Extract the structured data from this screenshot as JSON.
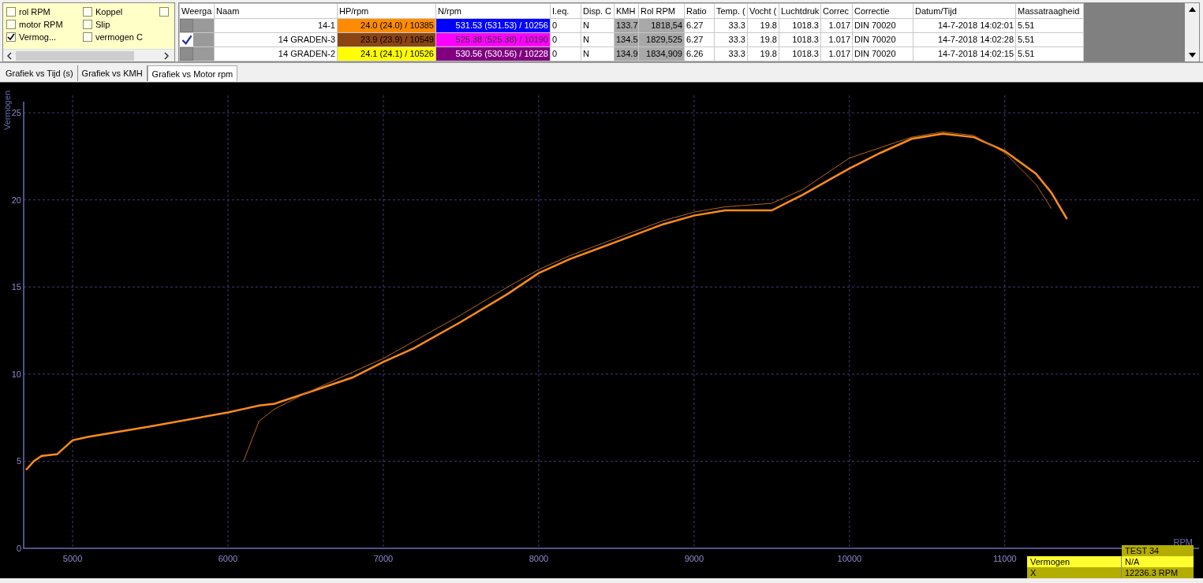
{
  "option_rows": [
    [
      {
        "label": "rol RPM",
        "checked": false
      },
      {
        "label": "Koppel",
        "checked": false
      },
      {
        "checked": false
      }
    ],
    [
      {
        "label": "motor RPM",
        "checked": false
      },
      {
        "label": "Slip",
        "checked": false
      }
    ],
    [
      {
        "label": "Vermog...",
        "checked": true
      },
      {
        "label": "vermogen C",
        "checked": false
      }
    ]
  ],
  "table": {
    "columns": [
      "Weerga",
      "Naam",
      "HP/rpm",
      "N/rpm",
      "I.eq.",
      "Disp. C",
      "KMH",
      "Rol RPM",
      "Ratio",
      "Temp. (",
      "Vocht (",
      "Luchtdruk",
      "Correc",
      "Correctie",
      "Datum/Tijd",
      "Massatraagheid"
    ],
    "rows": [
      {
        "shown": false,
        "naam": "14-1",
        "hp": {
          "text": "24.0 (24.0) / 10385",
          "color": "#ff8c00"
        },
        "n": {
          "text": "531.53 (531.53) / 10256",
          "color": "#0000ff"
        },
        "ieq": "0",
        "disp": "N",
        "kmh": "133.7",
        "rol_rpm": "1818,54",
        "ratio": "6.27",
        "temp": "33.3",
        "vocht": "19.8",
        "luchtdruk": "1018.3",
        "correc": "1.017",
        "correctie": "DIN 70020",
        "datum": "14-7-2018 14:02:01",
        "massa": "5.51"
      },
      {
        "shown": true,
        "naam": "14 GRADEN-3",
        "hp": {
          "text": "23.9 (23.9) / 10549",
          "color": "#8b4513"
        },
        "n": {
          "text": "525.38 (525.38) / 10190",
          "color": "#ff00ff"
        },
        "ieq": "0",
        "disp": "N",
        "kmh": "134.5",
        "rol_rpm": "1829,525",
        "ratio": "6.27",
        "temp": "33.3",
        "vocht": "19.8",
        "luchtdruk": "1018.3",
        "correc": "1.017",
        "correctie": "DIN 70020",
        "datum": "14-7-2018 14:02:28",
        "massa": "5.51"
      },
      {
        "shown": false,
        "naam": "14 GRADEN-2",
        "hp": {
          "text": "24.1 (24.1) / 10526",
          "color": "#ffff00"
        },
        "n": {
          "text": "530.56 (530.56) / 10228",
          "color": "#800080"
        },
        "ieq": "0",
        "disp": "N",
        "kmh": "134.9",
        "rol_rpm": "1834,909",
        "ratio": "6.26",
        "temp": "33.3",
        "vocht": "19.8",
        "luchtdruk": "1018.3",
        "correc": "1.017",
        "correctie": "DIN 70020",
        "datum": "14-7-2018 14:02:15",
        "massa": "5.51"
      }
    ]
  },
  "tabs": [
    {
      "label": "Grafiek vs Tijd (s)",
      "selected": false
    },
    {
      "label": "Grafiek vs KMH",
      "selected": false
    },
    {
      "label": "Grafiek vs Motor rpm",
      "selected": true
    }
  ],
  "chart": {
    "chart_data": {
      "type": "line",
      "xlabel": "RPM",
      "ylabel": "Vermogen",
      "grid": true,
      "x": [
        4700,
        4750,
        4800,
        4900,
        5000,
        5100,
        5500,
        6000,
        6100,
        6200,
        6300,
        6500,
        6800,
        7000,
        7200,
        7500,
        7800,
        8000,
        8200,
        8500,
        8800,
        9000,
        9200,
        9500,
        9700,
        9900,
        10000,
        10200,
        10400,
        10600,
        10800,
        11000,
        11200,
        11300,
        11400
      ],
      "series": [
        {
          "color": "#ff8c1a",
          "values": [
            4.5,
            5.0,
            5.3,
            5.4,
            6.2,
            6.4,
            7.0,
            7.8,
            8.0,
            8.2,
            8.3,
            8.9,
            9.8,
            10.7,
            11.5,
            13.0,
            14.6,
            15.8,
            16.6,
            17.6,
            18.6,
            19.1,
            19.4,
            19.4,
            20.3,
            21.3,
            21.8,
            22.7,
            23.5,
            23.8,
            23.6,
            22.8,
            21.5,
            20.4,
            18.9
          ]
        },
        {
          "color": "#b5651d",
          "values": [
            null,
            null,
            null,
            null,
            null,
            null,
            null,
            null,
            5.0,
            7.3,
            8.0,
            8.9,
            10.1,
            10.9,
            11.9,
            13.4,
            15.0,
            16.0,
            16.8,
            17.8,
            18.8,
            19.3,
            19.6,
            19.8,
            20.6,
            21.8,
            22.4,
            23.0,
            23.6,
            23.9,
            23.7,
            22.7,
            20.9,
            19.5,
            null
          ]
        }
      ],
      "xlim": [
        4685,
        12250
      ],
      "ylim": [
        0,
        26
      ],
      "xticks": [
        5000,
        6000,
        7000,
        8000,
        9000,
        10000,
        11000
      ],
      "yticks": [
        0,
        5,
        10,
        15,
        20,
        25
      ]
    },
    "info": {
      "title": "TEST  34",
      "rows": [
        {
          "label": "Vermogen",
          "value": "N/A"
        },
        {
          "label": "X",
          "value": "12236.3 RPM"
        }
      ]
    }
  }
}
